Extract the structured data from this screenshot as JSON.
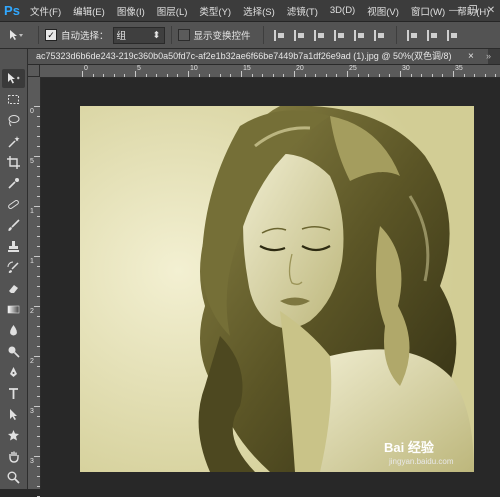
{
  "app": {
    "logo": "Ps"
  },
  "menu": [
    "文件(F)",
    "编辑(E)",
    "图像(I)",
    "图层(L)",
    "类型(Y)",
    "选择(S)",
    "滤镜(T)",
    "3D(D)",
    "视图(V)",
    "窗口(W)",
    "帮助(H)"
  ],
  "window_controls": {
    "minimize": "—",
    "restore": "❐",
    "close": "✕"
  },
  "options": {
    "auto_select_label": "自动选择：",
    "auto_select_value": "组",
    "show_transform_label": "显示变换控件"
  },
  "document": {
    "tab_title": "ac75323d6b6de243-219c360b0a50fd7c-af2e1b32ae6f66be7449b7a1df26e9ad (1).jpg @ 50%(双色调/8)",
    "close": "×",
    "more": "»"
  },
  "ruler_h_labels": [
    "0",
    "5",
    "10",
    "15",
    "20",
    "25",
    "30",
    "35"
  ],
  "ruler_v_labels": [
    "0",
    "5",
    "1",
    "1",
    "2",
    "2",
    "3",
    "3"
  ],
  "tools": [
    "move-tool",
    "marquee-tool",
    "lasso-tool",
    "magic-wand-tool",
    "crop-tool",
    "eyedropper-tool",
    "healing-brush-tool",
    "brush-tool",
    "clone-stamp-tool",
    "history-brush-tool",
    "eraser-tool",
    "gradient-tool",
    "blur-tool",
    "dodge-tool",
    "pen-tool",
    "type-tool",
    "path-selection-tool",
    "shape-tool",
    "hand-tool",
    "zoom-tool"
  ],
  "colors": {
    "accent": "#31a8ff",
    "photo_tint": "#d9d5a4"
  },
  "watermark": {
    "brand": "Bai 经验",
    "url": "jingyan.baidu.com"
  }
}
